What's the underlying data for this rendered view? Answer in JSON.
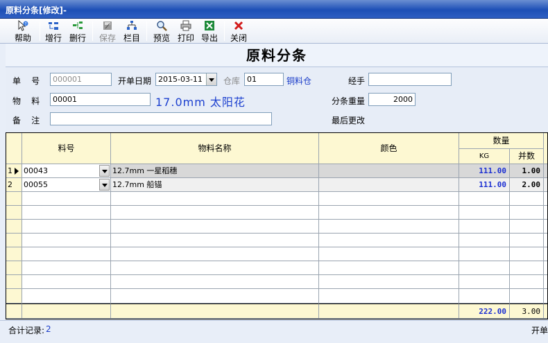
{
  "window": {
    "title": "原料分条[修改]-"
  },
  "toolbar": {
    "items": [
      {
        "label": "帮助",
        "icon": "help-icon"
      },
      {
        "label": "增行",
        "icon": "add-row-icon"
      },
      {
        "label": "删行",
        "icon": "delete-row-icon"
      },
      {
        "label": "保存",
        "icon": "save-icon",
        "disabled": true
      },
      {
        "label": "栏目",
        "icon": "columns-icon"
      },
      {
        "label": "预览",
        "icon": "preview-icon"
      },
      {
        "label": "打印",
        "icon": "print-icon"
      },
      {
        "label": "导出",
        "icon": "excel-export-icon"
      },
      {
        "label": "关闭",
        "icon": "close-icon"
      }
    ]
  },
  "header": {
    "title": "原料分条"
  },
  "form": {
    "doc_no_label": "单    号",
    "doc_no_value": "000001",
    "date_label": "开单日期",
    "date_value": "2015-03-11",
    "warehouse_label": "仓库",
    "warehouse_value": "01",
    "warehouse_name": "铜料仓",
    "handler_label": "经手",
    "handler_value": "",
    "material_label": "物    料",
    "material_value": "00001",
    "material_desc": "17.0mm 太阳花",
    "weight_label": "分条重量",
    "weight_value": "2000",
    "note_label": "备    注",
    "note_value": "",
    "last_modified_label": "最后更改"
  },
  "grid": {
    "headers": {
      "code": "料号",
      "name": "物料名称",
      "color": "颜色",
      "qty": "数量",
      "kg": "KG",
      "bundles": "并数"
    },
    "rows": [
      {
        "no": "1",
        "code": "00043",
        "name": "12.7mm 一星稻穗",
        "color": "",
        "kg": "111.00",
        "bundles": "1.00"
      },
      {
        "no": "2",
        "code": "00055",
        "name": "12.7mm 船锚",
        "color": "",
        "kg": "111.00",
        "bundles": "2.00"
      }
    ],
    "totals": {
      "kg": "222.00",
      "bundles": "3.00"
    }
  },
  "status": {
    "record_count_label": "合计记录:",
    "record_count": "2",
    "right_text": "开单"
  },
  "colors": {
    "title_bar": "#1d4fb6",
    "grid_header": "#fdf8d2",
    "accent_blue": "#1b3fcf"
  }
}
